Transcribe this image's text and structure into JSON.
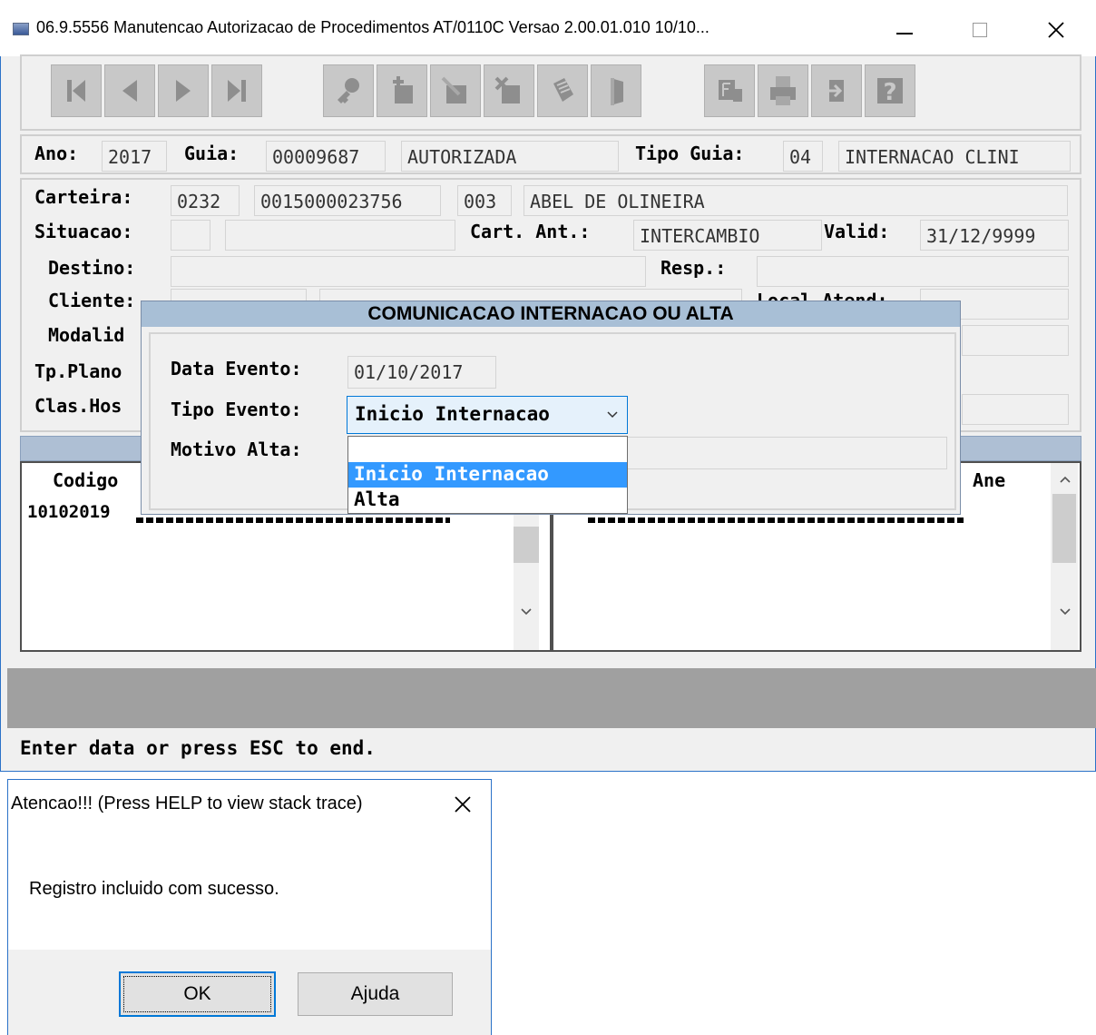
{
  "window": {
    "title": "06.9.5556 Manutencao Autorizacao de Procedimentos AT/0110C Versao 2.00.01.010 10/10...",
    "minimize_icon": "minimize-icon",
    "maximize_icon": "maximize-icon",
    "close_icon": "close-icon"
  },
  "toolbar": {
    "buttons": [
      "first-icon",
      "previous-icon",
      "next-icon",
      "last-icon",
      "search-key-icon",
      "add-icon",
      "edit-icon",
      "delete-icon",
      "copy-icon",
      "exit-door-icon",
      "filter-icon",
      "print-icon",
      "tools-icon",
      "help-icon"
    ]
  },
  "header": {
    "ano_label": "Ano:",
    "ano_value": "2017",
    "guia_label": "Guia:",
    "guia_value": "00009687",
    "status_value": "AUTORIZADA",
    "tipo_guia_label": "Tipo Guia:",
    "tipo_guia_code": "04",
    "tipo_guia_desc": "INTERNACAO CLINI"
  },
  "form": {
    "carteira_label": "Carteira:",
    "carteira_1": "0232",
    "carteira_2": "0015000023756",
    "carteira_3": "003",
    "beneficiario": "ABEL DE OLINEIRA",
    "situacao_label": "Situacao:",
    "cart_ant_label": "Cart. Ant.:",
    "cart_ant_value": "INTERCAMBIO",
    "valid_label": "Valid:",
    "valid_value": "31/12/9999",
    "destino_label": "Destino:",
    "resp_label": "Resp.:",
    "cliente_label": "Cliente:",
    "local_label": "Local.Atend:",
    "modalid_label": "Modalid",
    "tpplano_label": "Tp.Plano",
    "claship_label": "Clas.Hos"
  },
  "grid": {
    "left_header": "Codigo",
    "left_row": "10102019",
    "right_header": "Ane"
  },
  "status_bar": {
    "message": "Enter data or press ESC to end."
  },
  "popup": {
    "title": "COMUNICACAO INTERNACAO OU ALTA",
    "data_evento_label": "Data Evento:",
    "data_evento_value": "01/10/2017",
    "tipo_evento_label": "Tipo Evento:",
    "tipo_evento_value": "Inicio Internacao",
    "motivo_alta_label": "Motivo Alta:",
    "options": [
      "Inicio Internacao",
      "Alta"
    ]
  },
  "alert": {
    "title": "Atencao!!! (Press HELP to view stack trace)",
    "message": "Registro incluido com sucesso.",
    "ok_label": "OK",
    "help_label": "Ajuda"
  },
  "colors": {
    "selection": "#3399ff",
    "popup_title_bg": "#a8bfd6",
    "grid_header_bg": "#aebfd4",
    "status_strip": "#a0a0a0"
  }
}
